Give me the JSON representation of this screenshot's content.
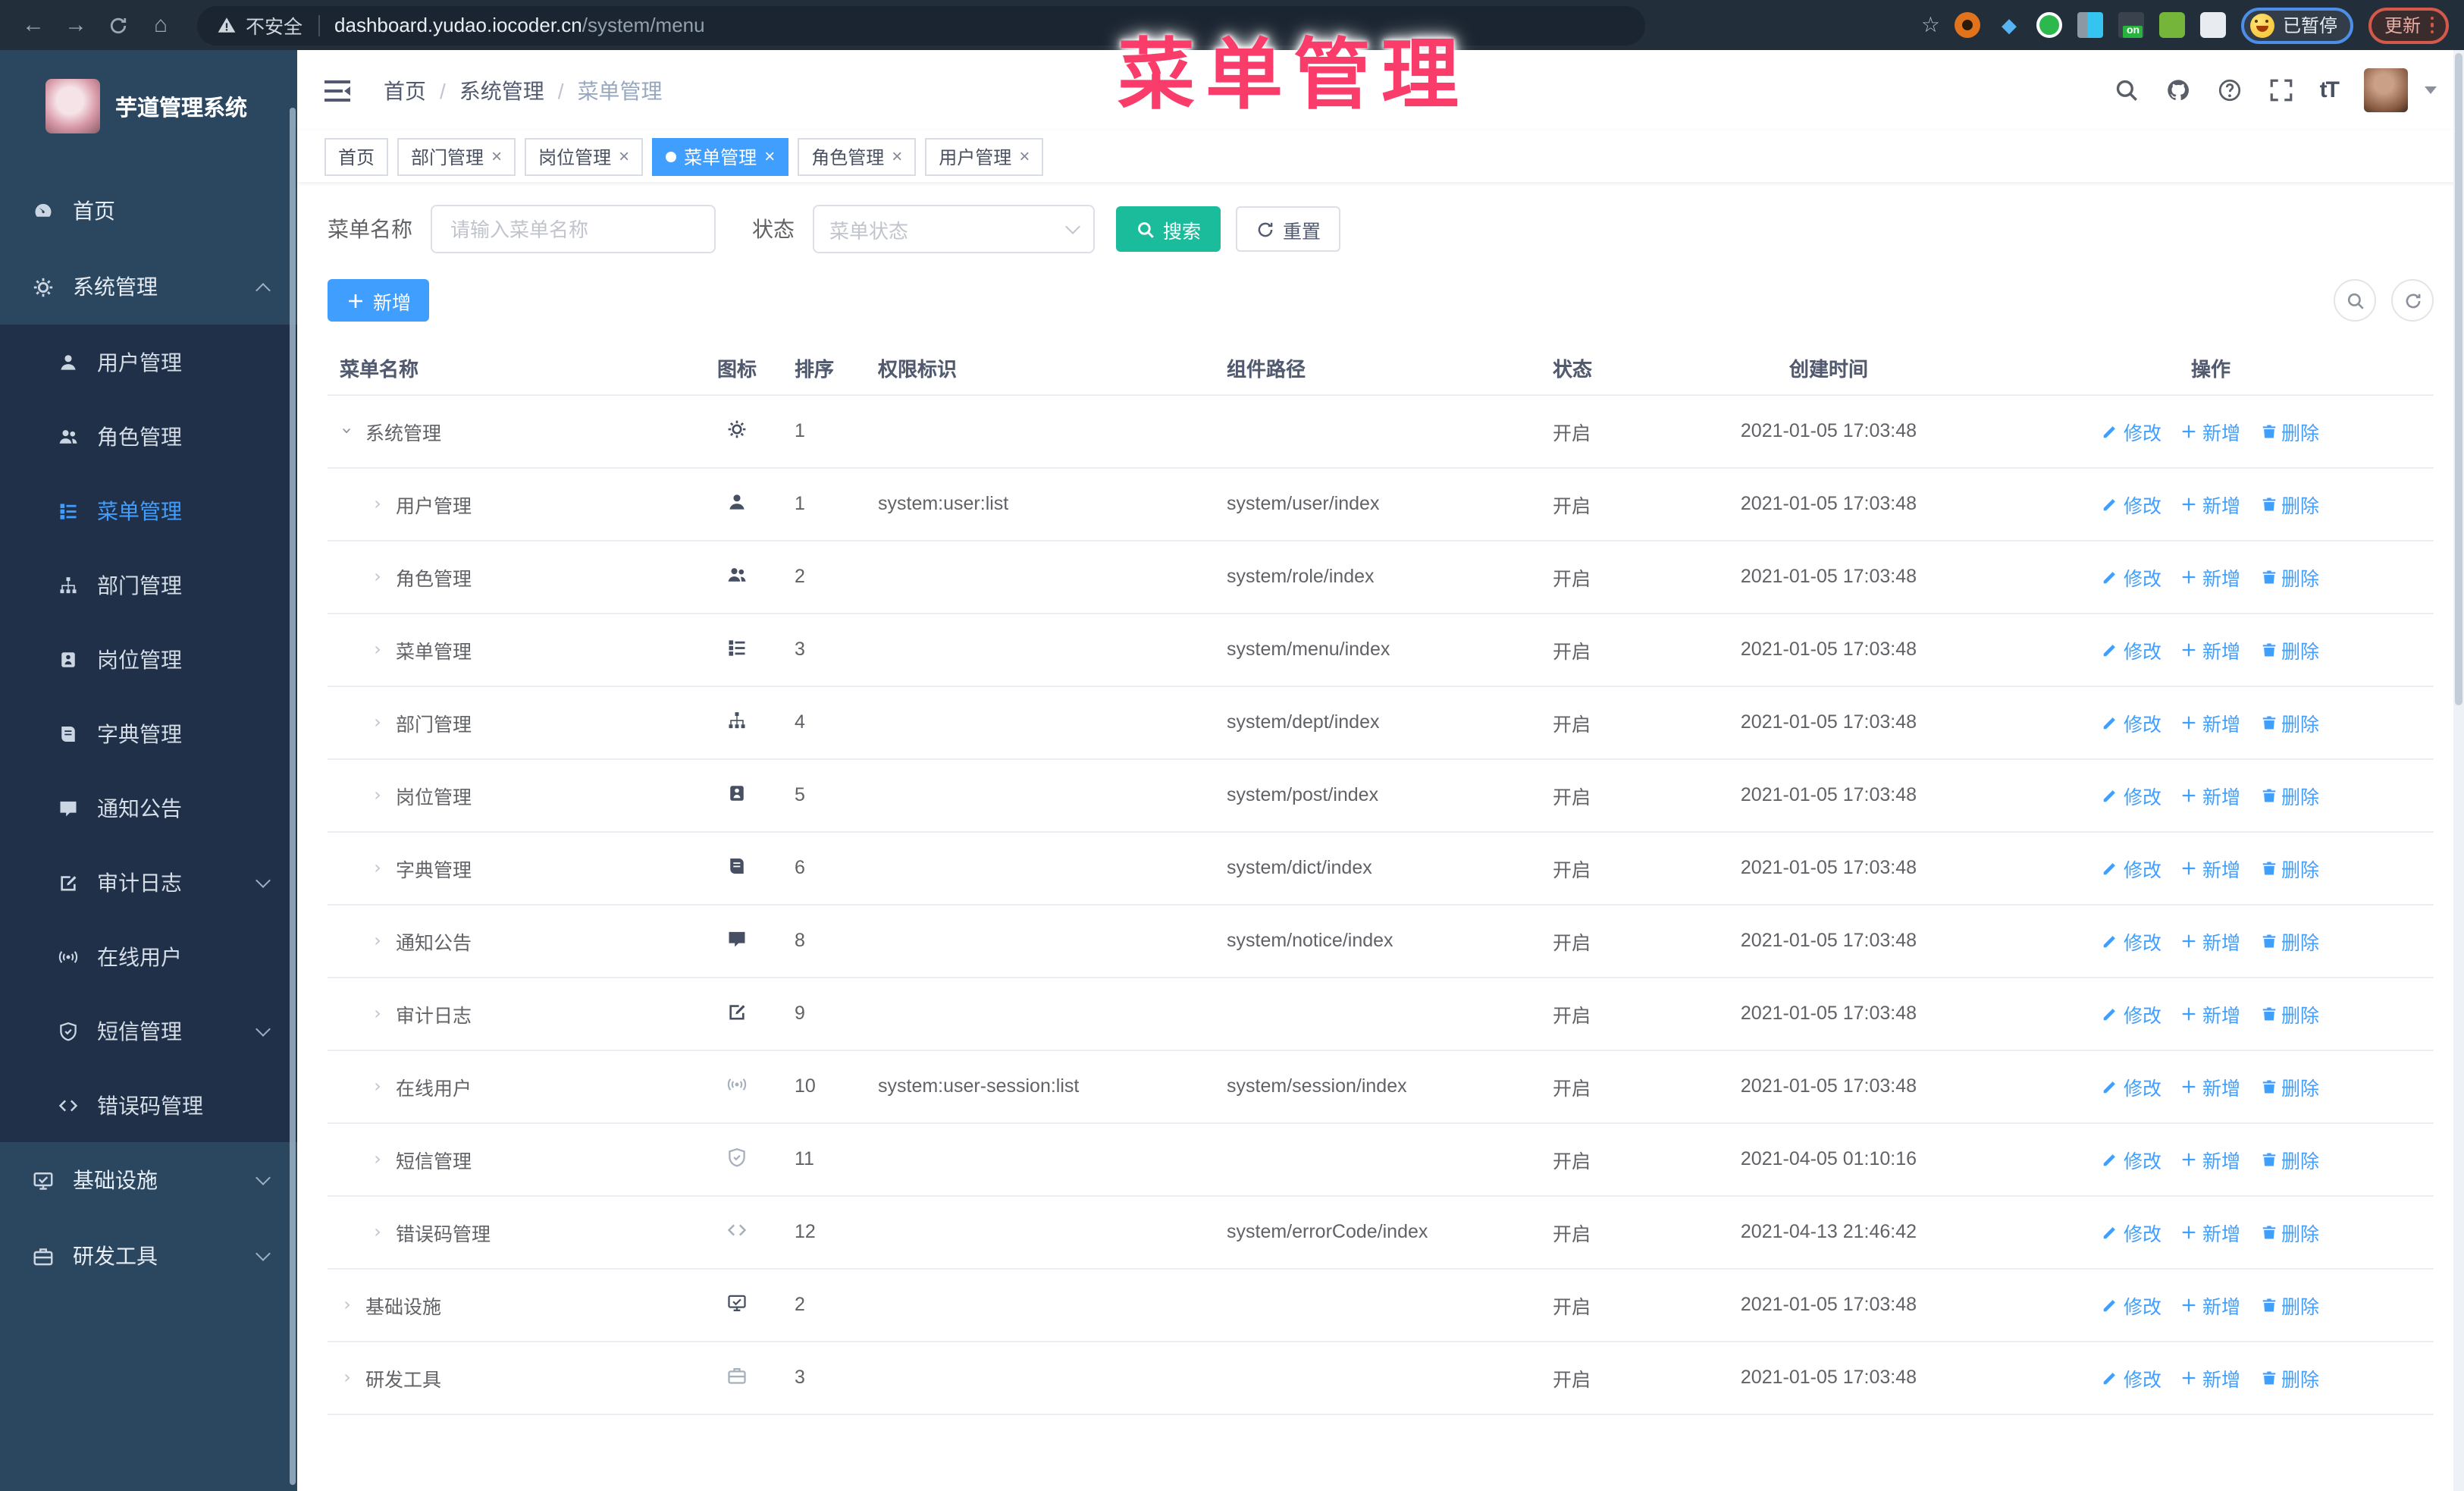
{
  "overlay_title": "菜单管理",
  "browser": {
    "security_label": "不安全",
    "url_host": "dashboard.yudao.iocoder.cn",
    "url_path": "/system/menu",
    "extensions_on_badge": "on",
    "paused_label": "已暂停",
    "update_label": "更新"
  },
  "sidebar": {
    "app_title": "芋道管理系统",
    "items": [
      {
        "label": "首页",
        "icon": "dashboard-icon"
      },
      {
        "label": "系统管理",
        "icon": "gear-icon"
      },
      {
        "label": "用户管理",
        "icon": "user-icon"
      },
      {
        "label": "角色管理",
        "icon": "users-icon"
      },
      {
        "label": "菜单管理",
        "icon": "menu-list-icon"
      },
      {
        "label": "部门管理",
        "icon": "org-tree-icon"
      },
      {
        "label": "岗位管理",
        "icon": "badge-icon"
      },
      {
        "label": "字典管理",
        "icon": "book-icon"
      },
      {
        "label": "通知公告",
        "icon": "message-icon"
      },
      {
        "label": "审计日志",
        "icon": "edit-log-icon"
      },
      {
        "label": "在线用户",
        "icon": "online-icon"
      },
      {
        "label": "短信管理",
        "icon": "shield-icon"
      },
      {
        "label": "错误码管理",
        "icon": "code-icon"
      },
      {
        "label": "基础设施",
        "icon": "monitor-icon"
      },
      {
        "label": "研发工具",
        "icon": "toolbox-icon"
      }
    ]
  },
  "header": {
    "breadcrumb": [
      "首页",
      "系统管理",
      "菜单管理"
    ],
    "breadcrumb_separator": "/"
  },
  "tags": [
    {
      "label": "首页"
    },
    {
      "label": "部门管理"
    },
    {
      "label": "岗位管理"
    },
    {
      "label": "菜单管理"
    },
    {
      "label": "角色管理"
    },
    {
      "label": "用户管理"
    }
  ],
  "filter": {
    "name_label": "菜单名称",
    "name_placeholder": "请输入菜单名称",
    "status_label": "状态",
    "status_placeholder": "菜单状态",
    "search_label": "搜索",
    "reset_label": "重置"
  },
  "toolbar": {
    "add_label": "新增"
  },
  "table": {
    "columns": [
      "菜单名称",
      "图标",
      "排序",
      "权限标识",
      "组件路径",
      "状态",
      "创建时间",
      "操作"
    ],
    "action_labels": {
      "edit": "修改",
      "add": "新增",
      "delete": "删除"
    },
    "rows": [
      {
        "name": "系统管理",
        "icon": "gear-icon",
        "sort": "1",
        "perm": "",
        "path": "",
        "status": "开启",
        "time": "2021-01-05 17:03:48"
      },
      {
        "name": "用户管理",
        "icon": "user-icon",
        "sort": "1",
        "perm": "system:user:list",
        "path": "system/user/index",
        "status": "开启",
        "time": "2021-01-05 17:03:48"
      },
      {
        "name": "角色管理",
        "icon": "users-icon",
        "sort": "2",
        "perm": "",
        "path": "system/role/index",
        "status": "开启",
        "time": "2021-01-05 17:03:48"
      },
      {
        "name": "菜单管理",
        "icon": "menu-list-icon",
        "sort": "3",
        "perm": "",
        "path": "system/menu/index",
        "status": "开启",
        "time": "2021-01-05 17:03:48"
      },
      {
        "name": "部门管理",
        "icon": "org-tree-icon",
        "sort": "4",
        "perm": "",
        "path": "system/dept/index",
        "status": "开启",
        "time": "2021-01-05 17:03:48"
      },
      {
        "name": "岗位管理",
        "icon": "badge-icon",
        "sort": "5",
        "perm": "",
        "path": "system/post/index",
        "status": "开启",
        "time": "2021-01-05 17:03:48"
      },
      {
        "name": "字典管理",
        "icon": "book-icon",
        "sort": "6",
        "perm": "",
        "path": "system/dict/index",
        "status": "开启",
        "time": "2021-01-05 17:03:48"
      },
      {
        "name": "通知公告",
        "icon": "message-icon",
        "sort": "8",
        "perm": "",
        "path": "system/notice/index",
        "status": "开启",
        "time": "2021-01-05 17:03:48"
      },
      {
        "name": "审计日志",
        "icon": "edit-log-icon",
        "sort": "9",
        "perm": "",
        "path": "",
        "status": "开启",
        "time": "2021-01-05 17:03:48"
      },
      {
        "name": "在线用户",
        "icon": "online-icon",
        "sort": "10",
        "perm": "system:user-session:list",
        "path": "system/session/index",
        "status": "开启",
        "time": "2021-01-05 17:03:48"
      },
      {
        "name": "短信管理",
        "icon": "shield-icon",
        "sort": "11",
        "perm": "",
        "path": "",
        "status": "开启",
        "time": "2021-04-05 01:10:16"
      },
      {
        "name": "错误码管理",
        "icon": "code-icon",
        "sort": "12",
        "perm": "",
        "path": "system/errorCode/index",
        "status": "开启",
        "time": "2021-04-13 21:46:42"
      },
      {
        "name": "基础设施",
        "icon": "monitor-icon",
        "sort": "2",
        "perm": "",
        "path": "",
        "status": "开启",
        "time": "2021-01-05 17:03:48"
      },
      {
        "name": "研发工具",
        "icon": "toolbox-icon",
        "sort": "3",
        "perm": "",
        "path": "",
        "status": "开启",
        "time": "2021-01-05 17:03:48"
      }
    ]
  }
}
